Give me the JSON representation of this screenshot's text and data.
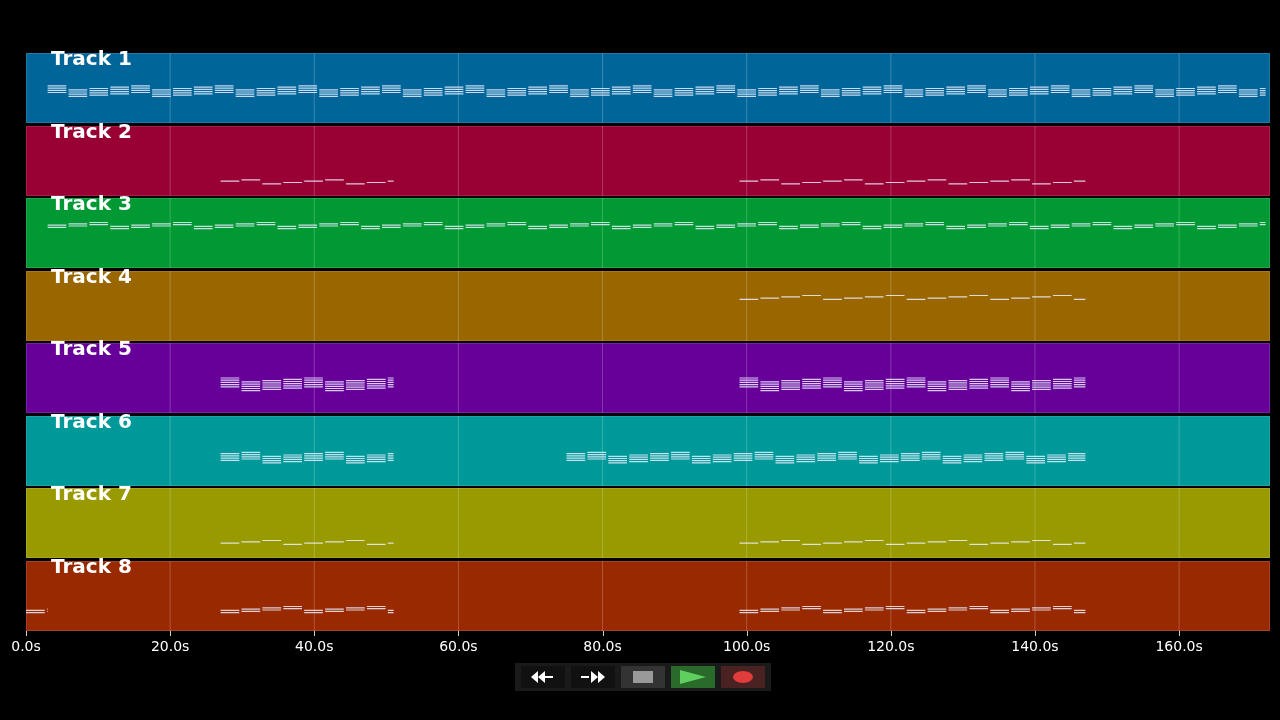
{
  "tracks": [
    {
      "name": "Track 1",
      "color": "#00669a"
    },
    {
      "name": "Track 2",
      "color": "#990033"
    },
    {
      "name": "Track 3",
      "color": "#009933"
    },
    {
      "name": "Track 4",
      "color": "#996600"
    },
    {
      "name": "Track 5",
      "color": "#660099"
    },
    {
      "name": "Track 6",
      "color": "#009999"
    },
    {
      "name": "Track 7",
      "color": "#999900"
    },
    {
      "name": "Track 8",
      "color": "#992900"
    }
  ],
  "axis": {
    "ticks": [
      "0.0s",
      "20.0s",
      "40.0s",
      "60.0s",
      "80.0s",
      "100.0s",
      "120.0s",
      "140.0s",
      "160.0s"
    ]
  },
  "transport": [
    {
      "kind": "rewind"
    },
    {
      "kind": "forward"
    },
    {
      "kind": "stop"
    },
    {
      "kind": "play"
    },
    {
      "kind": "record"
    }
  ]
}
